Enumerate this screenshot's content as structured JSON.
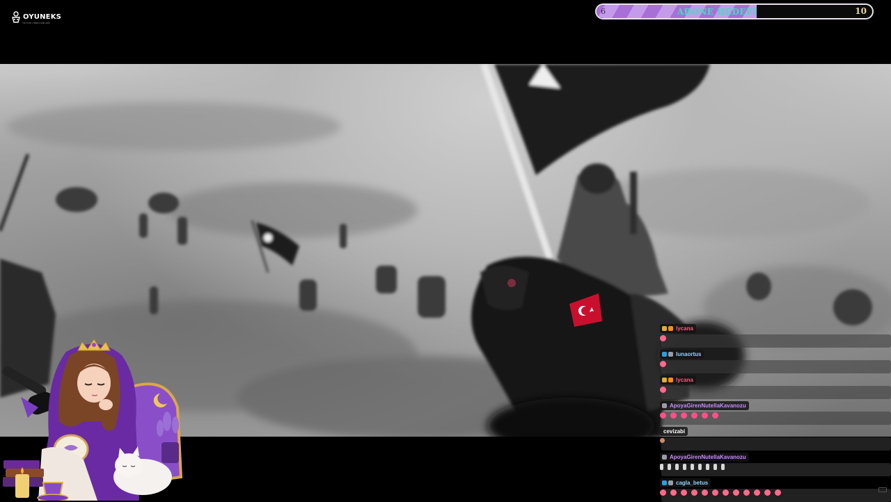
{
  "brand": {
    "name": "OYUNEKS",
    "tagline": "YAYINCI REKLAMLARI"
  },
  "goal": {
    "title": "ABONE HEDEFİ",
    "current": "6",
    "target": "10",
    "progress_fraction": 0.58
  },
  "chat": {
    "messages": [
      {
        "user": "lycana",
        "color": "#ff5a7a",
        "badges": [
          "crown-badge",
          "coin-badge"
        ],
        "emotes": [
          "heart-face-emote"
        ]
      },
      {
        "user": "lunaortus",
        "color": "#8fd3ff",
        "badges": [
          "globe-badge",
          "star-badge"
        ],
        "emotes": [
          "heart-face-emote"
        ]
      },
      {
        "user": "lycana",
        "color": "#ff5a7a",
        "badges": [
          "crown-badge",
          "coin-badge"
        ],
        "emotes": [
          "heart-face-emote"
        ]
      },
      {
        "user": "ApoyaGirenNutellaKavanozu",
        "color": "#c98cff",
        "badges": [
          "star-badge"
        ],
        "emotes": [
          "pink-feather-emote",
          "pink-feather-emote",
          "pink-feather-emote",
          "pink-feather-emote",
          "pink-feather-emote",
          "pink-feather-emote"
        ]
      },
      {
        "user": "cevizabi",
        "color": "#ffffff",
        "badges": [],
        "emotes": [
          "small-emote"
        ]
      },
      {
        "user": "ApoyaGirenNutellaKavanozu",
        "color": "#c98cff",
        "badges": [
          "star-badge"
        ],
        "emotes": [
          "candle-emote",
          "candle-emote",
          "candle-emote",
          "candle-emote",
          "candle-emote",
          "candle-emote",
          "candle-emote",
          "candle-emote",
          "candle-emote"
        ]
      },
      {
        "user": "cagla_betus",
        "color": "#8fd3ff",
        "badges": [
          "globe-badge",
          "star-badge"
        ],
        "emotes": [
          "heart-face-emote",
          "heart-face-emote",
          "heart-face-emote",
          "heart-face-emote",
          "heart-face-emote",
          "heart-face-emote",
          "heart-face-emote",
          "heart-face-emote",
          "heart-face-emote",
          "heart-face-emote",
          "heart-face-emote",
          "heart-face-emote"
        ]
      }
    ]
  },
  "colors": {
    "goal_border": "#e8e2ee",
    "goal_fill_a": "#c49bea",
    "goal_fill_b": "#a86fd6",
    "goal_title": "#3fdfc0",
    "avatar_purple": "#6a2aa3"
  }
}
